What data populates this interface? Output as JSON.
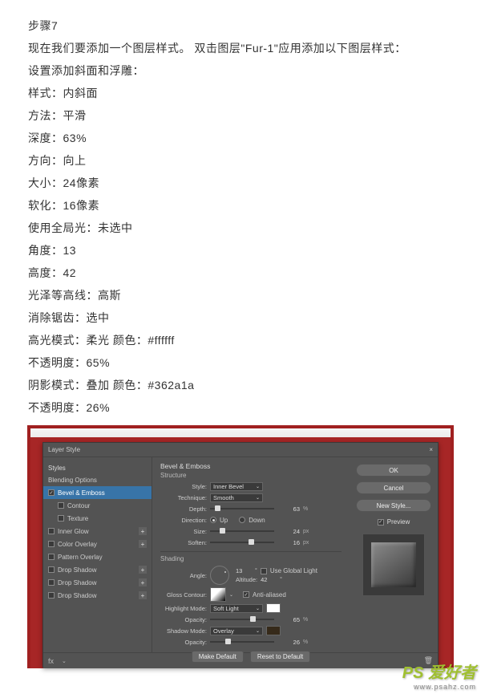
{
  "article": {
    "step_title": "步骤7",
    "intro": "现在我们要添加一个图层样式。 双击图层\"Fur-1\"应用添加以下图层样式：",
    "add_line": "设置添加斜面和浮雕：",
    "lines": [
      "样式：内斜面",
      "方法：平滑",
      "深度：63%",
      "方向：向上",
      "大小：24像素",
      "软化：16像素",
      "使用全局光：未选中",
      "角度：13",
      "高度：42",
      "光泽等高线：高斯",
      "消除锯齿：选中",
      "高光模式：柔光    颜色：#ffffff",
      "不透明度：65%",
      "阴影模式：叠加    颜色：#362a1a",
      "不透明度：26%"
    ]
  },
  "dialog": {
    "title": "Layer Style",
    "left": {
      "header": "Styles",
      "blending": "Blending Options",
      "items": [
        {
          "label": "Bevel & Emboss",
          "checked": true,
          "selected": true
        },
        {
          "label": "Contour",
          "checked": false,
          "sub": true
        },
        {
          "label": "Texture",
          "checked": false,
          "sub": true
        },
        {
          "label": "Inner Glow",
          "checked": false,
          "plus": true
        },
        {
          "label": "Color Overlay",
          "checked": false,
          "plus": true
        },
        {
          "label": "Pattern Overlay",
          "checked": false
        },
        {
          "label": "Drop Shadow",
          "checked": false,
          "plus": true
        },
        {
          "label": "Drop Shadow",
          "checked": false,
          "plus": true
        },
        {
          "label": "Drop Shadow",
          "checked": false,
          "plus": true
        }
      ]
    },
    "mid": {
      "section": "Bevel & Emboss",
      "structure": "Structure",
      "style_lbl": "Style:",
      "style_val": "Inner Bevel",
      "tech_lbl": "Technique:",
      "tech_val": "Smooth",
      "depth_lbl": "Depth:",
      "depth_val": "63",
      "pct": "%",
      "dir_lbl": "Direction:",
      "up": "Up",
      "down": "Down",
      "size_lbl": "Size:",
      "size_val": "24",
      "px": "px",
      "soften_lbl": "Soften:",
      "soften_val": "16",
      "shading": "Shading",
      "angle_lbl": "Angle:",
      "angle_val": "13",
      "ugl": "Use Global Light",
      "alt_lbl": "Altitude:",
      "alt_val": "42",
      "gloss_lbl": "Gloss Contour:",
      "aa": "Anti-aliased",
      "hl_lbl": "Highlight Mode:",
      "hl_val": "Soft Light",
      "op_lbl": "Opacity:",
      "hl_op": "65",
      "sh_lbl": "Shadow Mode:",
      "sh_val": "Overlay",
      "sh_op": "26",
      "make_default": "Make Default",
      "reset_default": "Reset to Default"
    },
    "right": {
      "ok": "OK",
      "cancel": "Cancel",
      "new_style": "New Style...",
      "preview": "Preview"
    }
  },
  "chart_data": {
    "type": "table",
    "title": "Bevel & Emboss settings",
    "rows": [
      [
        "Style",
        "Inner Bevel"
      ],
      [
        "Technique",
        "Smooth"
      ],
      [
        "Depth",
        "63%"
      ],
      [
        "Direction",
        "Up"
      ],
      [
        "Size",
        "24 px"
      ],
      [
        "Soften",
        "16 px"
      ],
      [
        "Angle",
        "13"
      ],
      [
        "Use Global Light",
        "false"
      ],
      [
        "Altitude",
        "42"
      ],
      [
        "Gloss Contour",
        "Gaussian"
      ],
      [
        "Anti-aliased",
        "true"
      ],
      [
        "Highlight Mode",
        "Soft Light"
      ],
      [
        "Highlight Color",
        "#ffffff"
      ],
      [
        "Highlight Opacity",
        "65%"
      ],
      [
        "Shadow Mode",
        "Overlay"
      ],
      [
        "Shadow Color",
        "#362a1a"
      ],
      [
        "Shadow Opacity",
        "26%"
      ]
    ]
  },
  "watermark": {
    "brand": "PS 爱好者",
    "url": "www.psahz.com"
  }
}
